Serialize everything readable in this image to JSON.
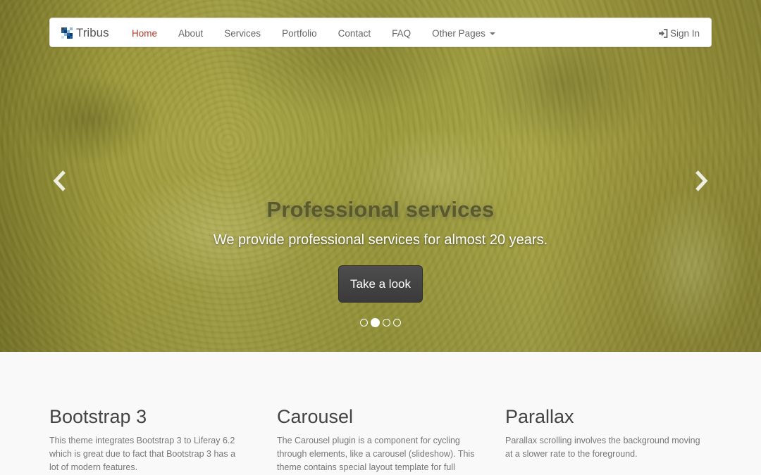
{
  "brand": {
    "name": "Tribus",
    "logo_colors": [
      "#1b5fa5",
      "#8fb8de",
      "#0e3f73",
      "#cfe0f0",
      "#444444"
    ]
  },
  "nav": {
    "items": [
      {
        "label": "Home",
        "active": true
      },
      {
        "label": "About",
        "active": false
      },
      {
        "label": "Services",
        "active": false
      },
      {
        "label": "Portfolio",
        "active": false
      },
      {
        "label": "Contact",
        "active": false
      },
      {
        "label": "FAQ",
        "active": false
      },
      {
        "label": "Other Pages",
        "active": false,
        "dropdown": true
      }
    ],
    "signin_label": "Sign In",
    "active_color": "#b43b2b"
  },
  "carousel": {
    "title": "Professional services",
    "subtitle": "We provide professional services for almost 20 years.",
    "button_label": "Take a look",
    "slide_count": 4,
    "active_index": 1,
    "prev_icon": "chevron-left-icon",
    "next_icon": "chevron-right-icon"
  },
  "features": [
    {
      "title": "Bootstrap 3",
      "lines": [
        "This theme integrates Bootstrap 3 to Liferay 6.2",
        "which is great due to fact that Bootstrap 3 has a",
        "lot of modern features."
      ]
    },
    {
      "title": "Carousel",
      "lines": [
        "The Carousel plugin is a component for cycling",
        "through elements, like a carousel (slideshow). This",
        "theme contains special layout template for full"
      ]
    },
    {
      "title": "Parallax",
      "lines": [
        "Parallax scrolling involves the background moving",
        "at a slower rate to the foreground."
      ]
    }
  ]
}
